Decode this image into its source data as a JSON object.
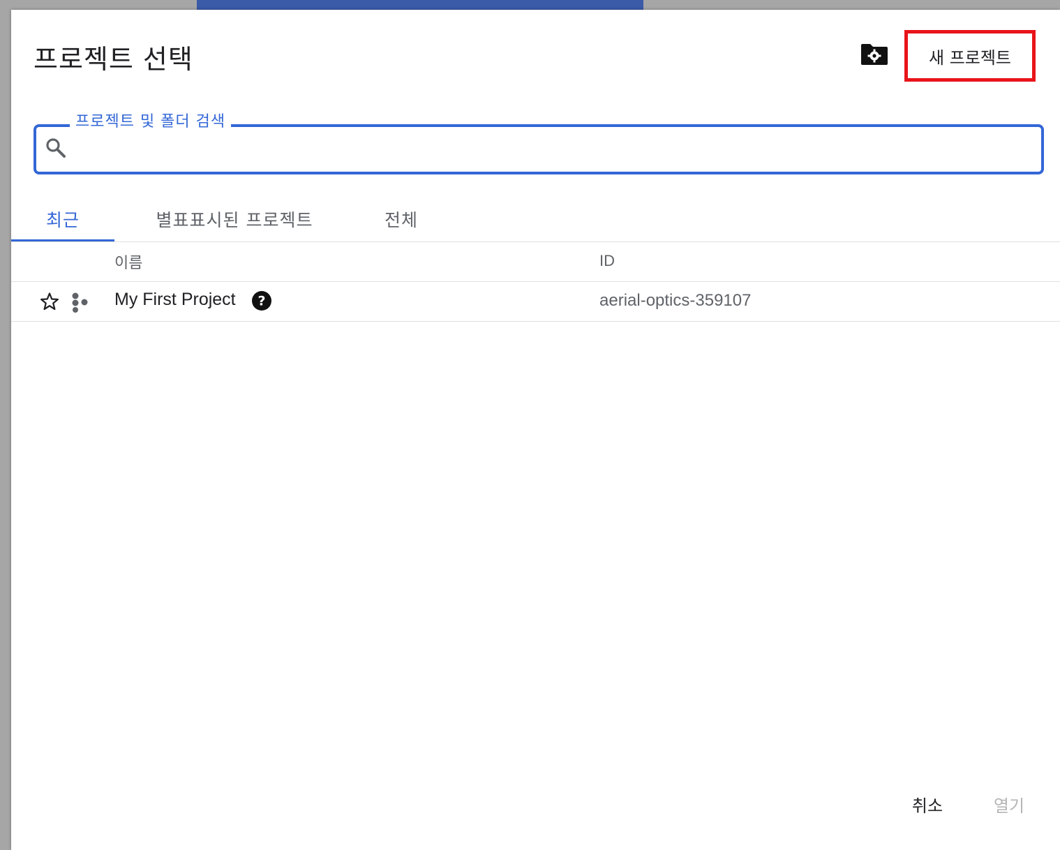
{
  "dialog": {
    "title": "프로젝트 선택",
    "new_project_label": "새 프로젝트"
  },
  "search": {
    "legend": "프로젝트 및 폴더 검색",
    "value": ""
  },
  "tabs": [
    {
      "label": "최근",
      "active": true
    },
    {
      "label": "별표표시된 프로젝트",
      "active": false
    },
    {
      "label": "전체",
      "active": false
    }
  ],
  "table": {
    "headers": {
      "name": "이름",
      "id": "ID"
    },
    "rows": [
      {
        "name": "My First Project",
        "id": "aerial-optics-359107",
        "starred": false
      }
    ]
  },
  "footer": {
    "cancel_label": "취소",
    "open_label": "열기"
  },
  "colors": {
    "accent": "#3367d6",
    "highlight": "#e8141a"
  },
  "icons": [
    "folder-settings-icon",
    "search-icon",
    "star-outline-icon",
    "organization-icon",
    "help-icon"
  ]
}
